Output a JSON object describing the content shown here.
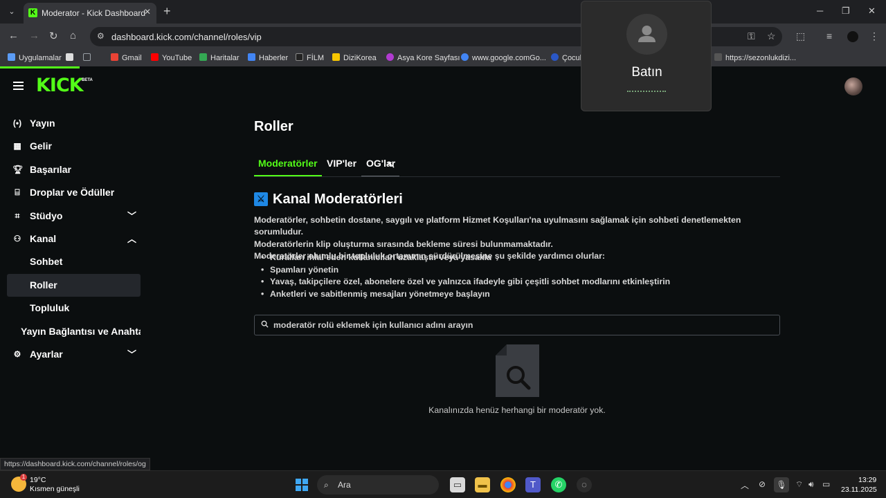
{
  "browser": {
    "tab_title": "Moderator - Kick Dashboard",
    "url": "dashboard.kick.com/channel/roles/vip",
    "status_url": "https://dashboard.kick.com/channel/roles/og",
    "bookmarks": [
      {
        "label": "Uygulamalar",
        "color": "#5b9cf5"
      },
      {
        "label": "",
        "color": "#dddddd"
      },
      {
        "label": "",
        "color": "#9aa0a6"
      },
      {
        "label": "Gmail",
        "color": "#ea4335"
      },
      {
        "label": "YouTube",
        "color": "#ff0000"
      },
      {
        "label": "Haritalar",
        "color": "#34a853"
      },
      {
        "label": "Haberler",
        "color": "#4285f4"
      },
      {
        "label": "FİLM",
        "color": "#222222"
      },
      {
        "label": "DiziKorea",
        "color": "#f7c600"
      },
      {
        "label": "Asya Kore Sayfası",
        "color": "#b13bd1"
      },
      {
        "label": "www.google.comGo...",
        "color": "#4285f4"
      },
      {
        "label": "Çocuk",
        "color": "#2a57c6"
      },
      {
        "label": "https://sezonlukdizi...",
        "color": "#555555"
      }
    ]
  },
  "header": {
    "logo_text": "KICK",
    "logo_badge": "BETA"
  },
  "sidebar": {
    "items": [
      {
        "label": "Yayın",
        "icon": "broadcast-icon"
      },
      {
        "label": "Gelir",
        "icon": "revenue-icon"
      },
      {
        "label": "Başarılar",
        "icon": "trophy-icon"
      },
      {
        "label": "Droplar ve Ödüller",
        "icon": "gift-icon"
      },
      {
        "label": "Stüdyo",
        "icon": "studio-icon"
      },
      {
        "label": "Kanal",
        "icon": "channel-icon"
      },
      {
        "label": "Sohbet"
      },
      {
        "label": "Roller"
      },
      {
        "label": "Topluluk"
      },
      {
        "label": "Yayın Bağlantısı ve Anahtar"
      },
      {
        "label": "Ayarlar",
        "icon": "settings-icon"
      }
    ]
  },
  "main": {
    "page_title": "Roller",
    "tabs": [
      {
        "label": "Moderatörler"
      },
      {
        "label": "VIP'ler"
      },
      {
        "label": "OG'lar"
      }
    ],
    "section_title": "Kanal Moderatörleri",
    "description": [
      "Moderatörler, sohbetin dostane, saygılı ve platform Hizmet Koşulları'na uyulmasını sağlamak için sohbeti denetlemekten sorumludur.",
      "Moderatörlerin klip oluşturma sırasında bekleme süresi bulunmamaktadır.",
      "Moderatörler olumlu bir topluluk ortamının sürdürülmesine şu şekilde yardımcı olurlar:"
    ],
    "bullets": [
      "Kuralları ihlal eden kullanıcıları uzaklaştır veya yasakla",
      "Spamları yönetin",
      "Yavaş, takipçilere özel, abonelere özel ve yalnızca ifadeyle gibi çeşitli sohbet modlarını etkinleştirin",
      "Anketleri ve sabitlenmiş mesajları yönetmeye başlayın"
    ],
    "search_placeholder": "moderatör rolü eklemek için kullanıcı adını arayın",
    "empty_text": "Kanalınızda henüz herhangi bir moderatör yok."
  },
  "call_popup": {
    "name": "Batın"
  },
  "taskbar": {
    "temperature": "19°C",
    "weather": "Kısmen güneşli",
    "weather_badge": "1",
    "search_label": "Ara",
    "time": "13:29",
    "date": "23.11.2025"
  },
  "colors": {
    "accent": "#53fc18",
    "background": "#0b0e0f",
    "active_item": "#24272c"
  }
}
